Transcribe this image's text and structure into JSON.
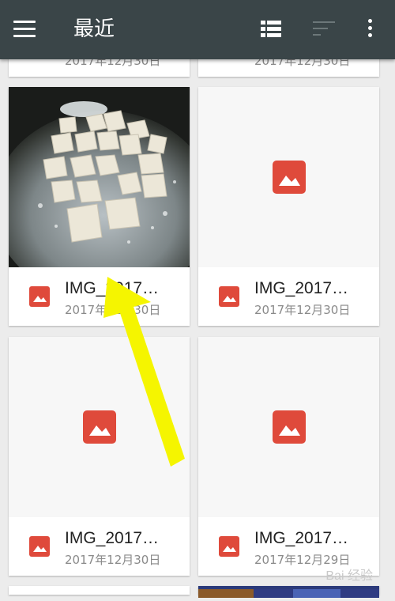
{
  "appbar": {
    "title": "最近",
    "icons": [
      "menu-icon",
      "list-view-icon",
      "sort-icon",
      "more-vert-icon"
    ]
  },
  "top_partial": {
    "left_date": "2017年12月30日",
    "right_date": "2017年12月30日"
  },
  "files": [
    {
      "name": "IMG_2017…",
      "date": "2017年12月30日",
      "thumbnail": "tofu-photo"
    },
    {
      "name": "IMG_2017…",
      "date": "2017年12月30日",
      "thumbnail": "image-placeholder-icon"
    },
    {
      "name": "IMG_2017…",
      "date": "2017年12月30日",
      "thumbnail": "image-placeholder-icon"
    },
    {
      "name": "IMG_2017…",
      "date": "2017年12月29日",
      "thumbnail": "image-placeholder-icon"
    }
  ],
  "watermark": "Bai 经验",
  "colors": {
    "appbar": "#3a4548",
    "file_icon": "#df4a3b",
    "arrow": "#f5f500",
    "background": "#ececec"
  }
}
